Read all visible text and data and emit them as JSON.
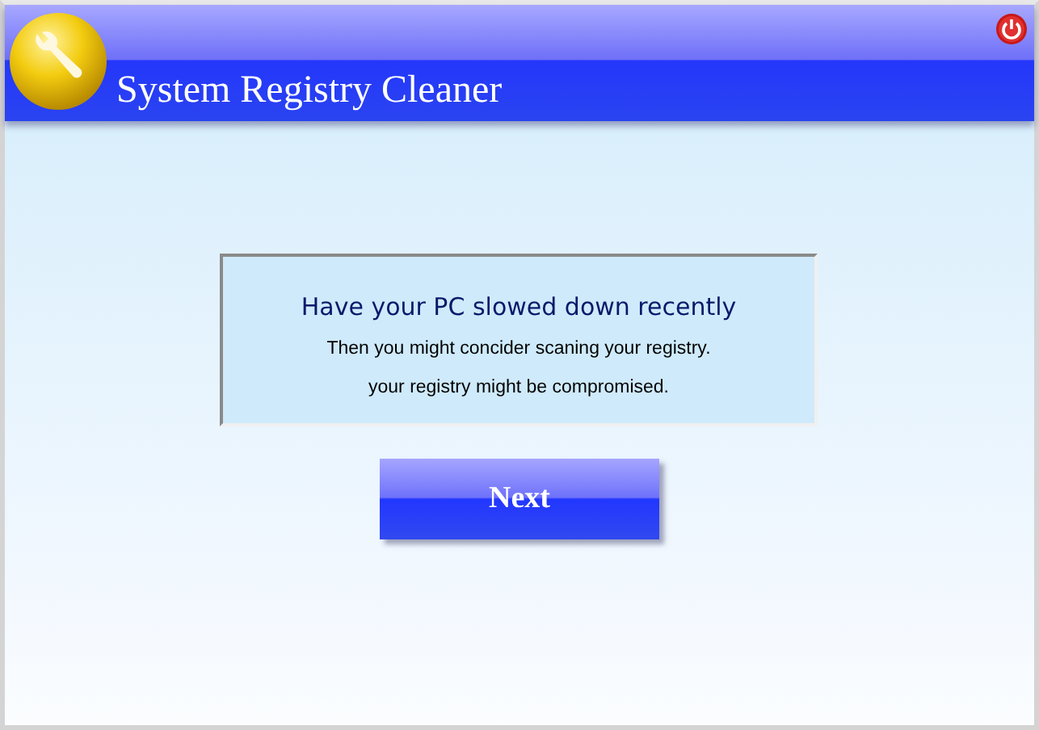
{
  "window": {
    "title": "System Registry Cleaner"
  },
  "message": {
    "heading": "Have your PC slowed down recently",
    "lines": [
      "Then you might concider scaning your registry.",
      "your registry might be compromised."
    ]
  },
  "buttons": [
    "Next"
  ]
}
